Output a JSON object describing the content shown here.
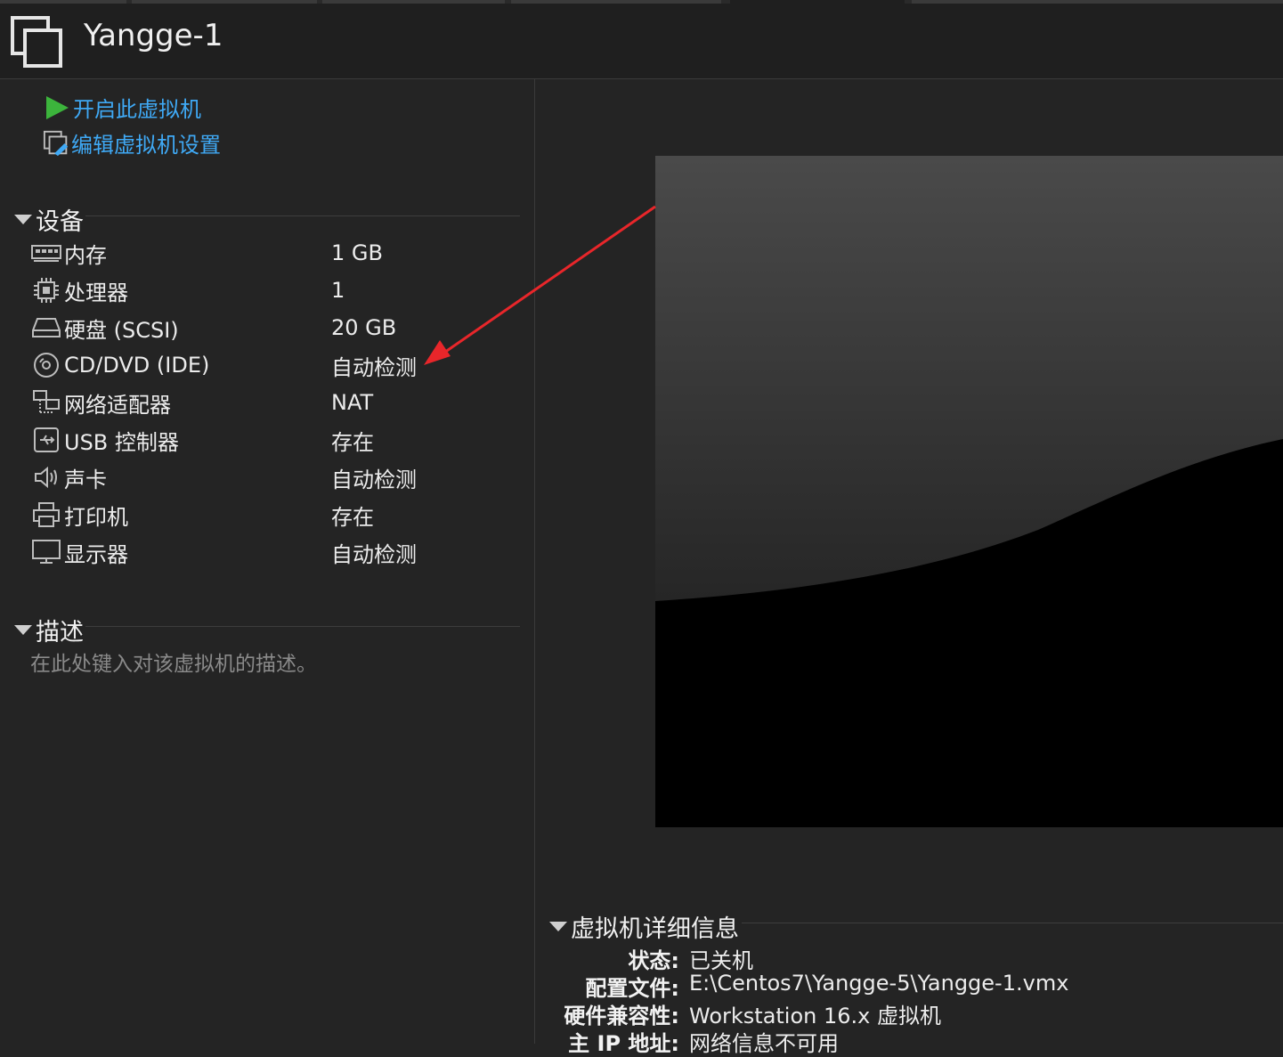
{
  "window": {
    "title": "Yangge-1"
  },
  "actions": {
    "power_on": "开启此虚拟机",
    "edit_settings": "编辑虚拟机设置"
  },
  "devices": {
    "title": "设备",
    "items": [
      {
        "name": "内存",
        "value": "1 GB",
        "icon": "memory-icon"
      },
      {
        "name": "处理器",
        "value": "1",
        "icon": "processor-icon"
      },
      {
        "name": "硬盘 (SCSI)",
        "value": "20 GB",
        "icon": "hard-disk-icon"
      },
      {
        "name": "CD/DVD (IDE)",
        "value": "自动检测",
        "icon": "cd-dvd-icon"
      },
      {
        "name": "网络适配器",
        "value": "NAT",
        "icon": "network-adapter-icon"
      },
      {
        "name": "USB 控制器",
        "value": "存在",
        "icon": "usb-controller-icon"
      },
      {
        "name": "声卡",
        "value": "自动检测",
        "icon": "sound-card-icon"
      },
      {
        "name": "打印机",
        "value": "存在",
        "icon": "printer-icon"
      },
      {
        "name": "显示器",
        "value": "自动检测",
        "icon": "display-icon"
      }
    ]
  },
  "description": {
    "title": "描述",
    "placeholder": "在此处键入对该虚拟机的描述。"
  },
  "details": {
    "title": "虚拟机详细信息",
    "rows": [
      {
        "key": "状态:",
        "value": "已关机"
      },
      {
        "key": "配置文件:",
        "value": "E:\\Centos7\\Yangge-5\\Yangge-1.vmx"
      },
      {
        "key": "硬件兼容性:",
        "value": "Workstation 16.x 虚拟机"
      },
      {
        "key": "主 IP 地址:",
        "value": "网络信息不可用"
      }
    ]
  },
  "colors": {
    "accent_link": "#3fa9f5",
    "power_green": "#3cb43c",
    "annotation_arrow": "#e8262a"
  }
}
